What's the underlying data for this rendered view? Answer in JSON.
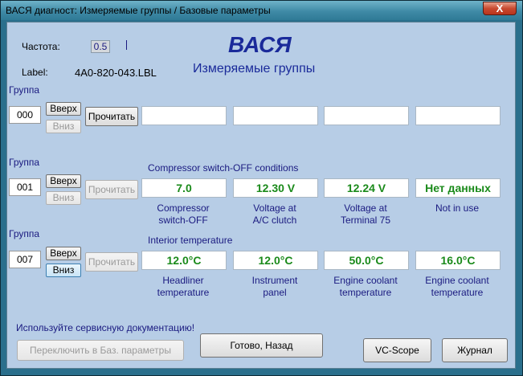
{
  "window": {
    "title": "ВАСЯ диагност: Измеряемые группы / Базовые параметры",
    "close_label": "X"
  },
  "header": {
    "freq_label": "Частота:",
    "freq_value": "0.5",
    "label_caption": "Label:",
    "label_value": "4A0-820-043.LBL",
    "brand": "ВАСЯ",
    "subtitle": "Измеряемые группы"
  },
  "groups": [
    {
      "label": "Группа",
      "number": "000",
      "up_label": "Вверх",
      "down_label": "Вниз",
      "read_label": "Прочитать",
      "header": "",
      "values": [
        "",
        "",
        "",
        ""
      ],
      "units": [
        "",
        "",
        "",
        ""
      ]
    },
    {
      "label": "Группа",
      "number": "001",
      "up_label": "Вверх",
      "down_label": "Вниз",
      "read_label": "Прочитать",
      "header": "Compressor switch-OFF conditions",
      "values": [
        "7.0",
        "12.30 V",
        "12.24 V",
        "Нет данных"
      ],
      "units": [
        "Compressor\nswitch-OFF",
        "Voltage at\nA/C clutch",
        "Voltage at\nTerminal 75",
        "Not in use"
      ]
    },
    {
      "label": "Группа",
      "number": "007",
      "up_label": "Вверх",
      "down_label": "Вниз",
      "read_label": "Прочитать",
      "header": "Interior temperature",
      "values": [
        "12.0°C",
        "12.0°C",
        "50.0°C",
        "16.0°C"
      ],
      "units": [
        "Headliner\ntemperature",
        "Instrument\npanel",
        "Engine coolant\ntemperature",
        "Engine coolant\ntemperature"
      ]
    }
  ],
  "footer": {
    "notice": "Используйте сервисную документацию!",
    "basic_settings_label": "Переключить в Баз. параметры",
    "done_label": "Готово, Назад",
    "vcscope_label": "VC-Scope",
    "journal_label": "Журнал"
  },
  "colors": {
    "value_green": "#1a8a1a",
    "label_blue": "#1a1a80",
    "client_bg": "#b7cde6"
  }
}
